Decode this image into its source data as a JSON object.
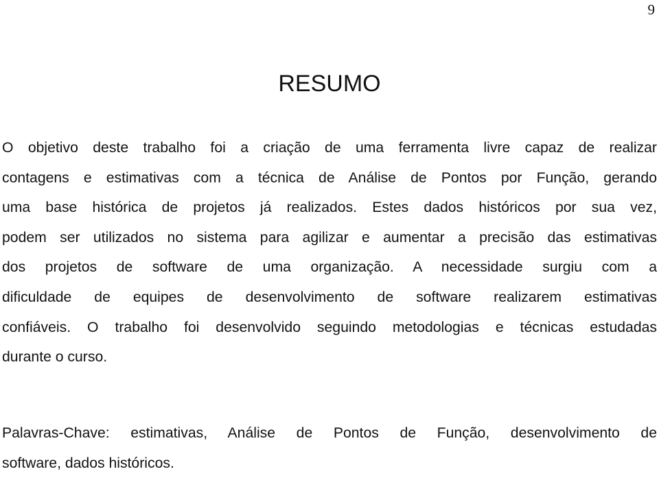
{
  "page": {
    "number": "9"
  },
  "title": "RESUMO",
  "abstract": {
    "lines": [
      "O objetivo deste trabalho foi a criação de uma ferramenta livre capaz de realizar",
      "contagens e estimativas com a técnica de Análise de Pontos por Função, gerando",
      "uma base histórica de projetos já realizados. Estes dados históricos por sua vez,",
      "podem ser utilizados no sistema para agilizar e aumentar a precisão das estimativas",
      "dos projetos de software de uma organização. A necessidade surgiu com a",
      "dificuldade de equipes de desenvolvimento de software realizarem estimativas",
      "confiáveis. O trabalho foi desenvolvido seguindo metodologias e técnicas estudadas",
      "durante o curso."
    ]
  },
  "keywords": {
    "lines": [
      "Palavras-Chave: estimativas, Análise de Pontos de Função, desenvolvimento de",
      "software, dados históricos."
    ]
  }
}
